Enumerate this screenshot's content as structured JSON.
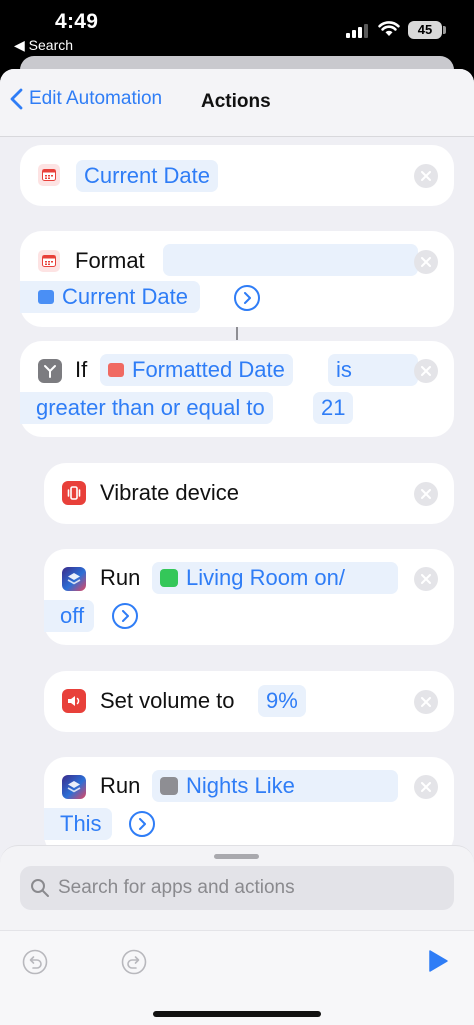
{
  "status_bar": {
    "time": "4:49",
    "back_label": "◀ Search",
    "battery": "45"
  },
  "nav": {
    "back_label": "Edit Automation",
    "title": "Actions"
  },
  "actions": {
    "current_date": {
      "token": "Current Date"
    },
    "format": {
      "verb": "Format",
      "token": "Current Date"
    },
    "if": {
      "verb": "If",
      "token": "Formatted Date",
      "comparator_line1": "is",
      "comparator_line2": "greater than or equal to",
      "value": "21"
    },
    "vibrate": {
      "label": "Vibrate device"
    },
    "run_living_room": {
      "verb": "Run",
      "token_line1": "Living Room on/",
      "token_line2": "off"
    },
    "set_volume": {
      "label": "Set volume to",
      "value": "9%"
    },
    "run_nights": {
      "verb": "Run",
      "token_line1": "Nights Like",
      "token_line2": "This"
    }
  },
  "bottom": {
    "search_placeholder": "Search for apps and actions"
  },
  "colors": {
    "accent": "#2f7df6",
    "sheet_bg": "#efeff4",
    "card_bg": "#ffffff",
    "token_bg": "#e9f1fc",
    "calendar_red": "#e8403a"
  },
  "icons": [
    "calendar-icon",
    "if-branch-icon",
    "vibrate-icon",
    "shortcut-icon",
    "home-scene-icon",
    "volume-icon",
    "search-icon",
    "undo-icon",
    "redo-icon",
    "play-icon",
    "close-icon",
    "chevron-right-icon"
  ]
}
